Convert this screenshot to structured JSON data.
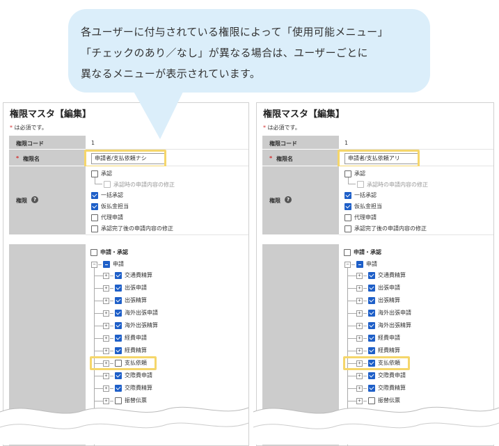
{
  "bubble": {
    "line1": "各ユーザーに付与されている権限によって「使用可能メニュー」",
    "line2": "「チェックのあり／なし」が異なる場合は、ユーザーごとに",
    "line3": "異なるメニューが表示されています。"
  },
  "colors": {
    "highlight": "#f5d66b",
    "bubble_bg": "#dbeefa",
    "label_bg": "#cccccc",
    "checkbox_checked": "#1e5fc8",
    "required": "#d32f2f"
  },
  "left": {
    "title": "権限マスタ【編集】",
    "required_note": "は必須です。",
    "required_mark": "*",
    "code_label": "権限コード",
    "code_value": "1",
    "name_label": "権限名",
    "name_value": "申請者/支払依頼ナシ",
    "perm_label": "権限",
    "help_icon": "?",
    "perms": [
      {
        "label": "承認",
        "checked": false
      },
      {
        "label": "承認時の申請内容の修正",
        "checked": false
      },
      {
        "label": "一括承認",
        "checked": true
      },
      {
        "label": "仮払金担当",
        "checked": true
      },
      {
        "label": "代理申請",
        "checked": false
      },
      {
        "label": "承認完了後の申請内容の修正",
        "checked": false
      }
    ],
    "tree_root": "申請・承認",
    "tree_group": "申請",
    "tree_items": [
      {
        "label": "交通費精算",
        "checked": true
      },
      {
        "label": "出張申請",
        "checked": true
      },
      {
        "label": "出張精算",
        "checked": true
      },
      {
        "label": "海外出張申請",
        "checked": true
      },
      {
        "label": "海外出張精算",
        "checked": true
      },
      {
        "label": "経費申請",
        "checked": true
      },
      {
        "label": "経費精算",
        "checked": true
      },
      {
        "label": "支払依頼",
        "checked": false
      },
      {
        "label": "交際費申請",
        "checked": true
      },
      {
        "label": "交際費精算",
        "checked": true
      },
      {
        "label": "振替伝票",
        "checked": false
      }
    ]
  },
  "right": {
    "title": "権限マスタ【編集】",
    "required_note": "は必須です。",
    "required_mark": "*",
    "code_label": "権限コード",
    "code_value": "1",
    "name_label": "権限名",
    "name_value": "申請者/支払依頼アリ",
    "perm_label": "権限",
    "help_icon": "?",
    "perms": [
      {
        "label": "承認",
        "checked": false
      },
      {
        "label": "承認時の申請内容の修正",
        "checked": false
      },
      {
        "label": "一括承認",
        "checked": true
      },
      {
        "label": "仮払金担当",
        "checked": true
      },
      {
        "label": "代理申請",
        "checked": false
      },
      {
        "label": "承認完了後の申請内容の修正",
        "checked": false
      }
    ],
    "tree_root": "申請・承認",
    "tree_group": "申請",
    "tree_items": [
      {
        "label": "交通費精算",
        "checked": true
      },
      {
        "label": "出張申請",
        "checked": true
      },
      {
        "label": "出張精算",
        "checked": true
      },
      {
        "label": "海外出張申請",
        "checked": true
      },
      {
        "label": "海外出張精算",
        "checked": true
      },
      {
        "label": "経費申請",
        "checked": true
      },
      {
        "label": "経費精算",
        "checked": true
      },
      {
        "label": "支払依頼",
        "checked": true
      },
      {
        "label": "交際費申請",
        "checked": true
      },
      {
        "label": "交際費精算",
        "checked": true
      },
      {
        "label": "振替伝票",
        "checked": false
      }
    ]
  }
}
